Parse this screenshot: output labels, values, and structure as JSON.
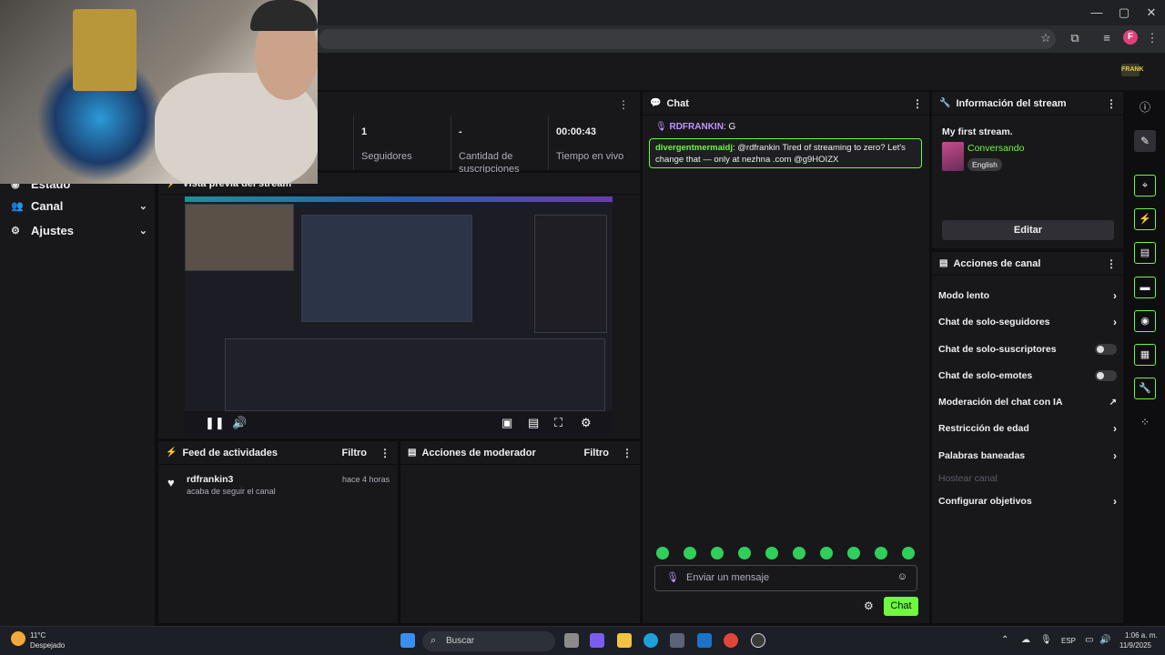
{
  "browser": {
    "window_controls": {
      "minimize": "—",
      "maximize": "▢",
      "close": "✕"
    },
    "profile_initial": "F"
  },
  "left_nav": {
    "partial_label": "Estado",
    "items": [
      {
        "label": "Canal",
        "icon": "users-icon"
      },
      {
        "label": "Ajustes",
        "icon": "gear-icon"
      }
    ]
  },
  "stats": [
    {
      "value": "1",
      "label": "Seguidores"
    },
    {
      "value": "-",
      "label": "Cantidad de suscripciones"
    },
    {
      "value": "00:00:43",
      "label": "Tiempo en vivo"
    }
  ],
  "preview": {
    "title": "Vista previa del stream"
  },
  "activity_feed": {
    "title": "Feed de actividades",
    "filter": "Filtro",
    "items": [
      {
        "user": "rdfrankin3",
        "time": "hace 4 horas",
        "text": "acaba de seguir el canal"
      }
    ]
  },
  "mod_actions": {
    "title": "Acciones de moderador",
    "filter": "Filtro"
  },
  "chat": {
    "title": "Chat",
    "messages": [
      {
        "user": "RDFRANKIN",
        "text": "G",
        "user_color": "#bf94ff"
      }
    ],
    "pinned": {
      "user": "divergentmermaidj",
      "text": "@rdfrankin Tired of streaming to zero? Let's change that — only at nezhna .com @g9HOIZX",
      "user_color": "#6ff83f"
    },
    "input_placeholder": "Enviar un mensaje",
    "send_label": "Chat"
  },
  "stream_info": {
    "title": "Información del stream",
    "stream_title": "My first stream.",
    "category": "Conversando",
    "tag": "English",
    "edit_label": "Editar"
  },
  "channel_actions": {
    "title": "Acciones de canal",
    "items": [
      {
        "label": "Modo lento",
        "control": "chevron"
      },
      {
        "label": "Chat de solo-seguidores",
        "control": "chevron"
      },
      {
        "label": "Chat de solo-suscriptores",
        "control": "toggle",
        "enabled": false
      },
      {
        "label": "Chat de solo-emotes",
        "control": "toggle",
        "enabled": false
      },
      {
        "label": "Moderación del chat con IA",
        "control": "external"
      },
      {
        "label": "Restricción de edad",
        "control": "chevron"
      },
      {
        "label": "Palabras baneadas",
        "control": "chevron"
      },
      {
        "label": "Hostear canal",
        "control": "none",
        "disabled": true
      },
      {
        "label": "Configurar objetivos",
        "control": "chevron"
      }
    ]
  },
  "taskbar": {
    "weather_temp": "11°C",
    "weather_desc": "Despejado",
    "search_placeholder": "Buscar",
    "lang": "ESP",
    "time": "1:06 a. m.",
    "date": "11/9/2025"
  },
  "colors": {
    "accent": "#6ff83f",
    "purple": "#bf94ff",
    "bg": "#0e0e10",
    "panel": "#18181b"
  }
}
